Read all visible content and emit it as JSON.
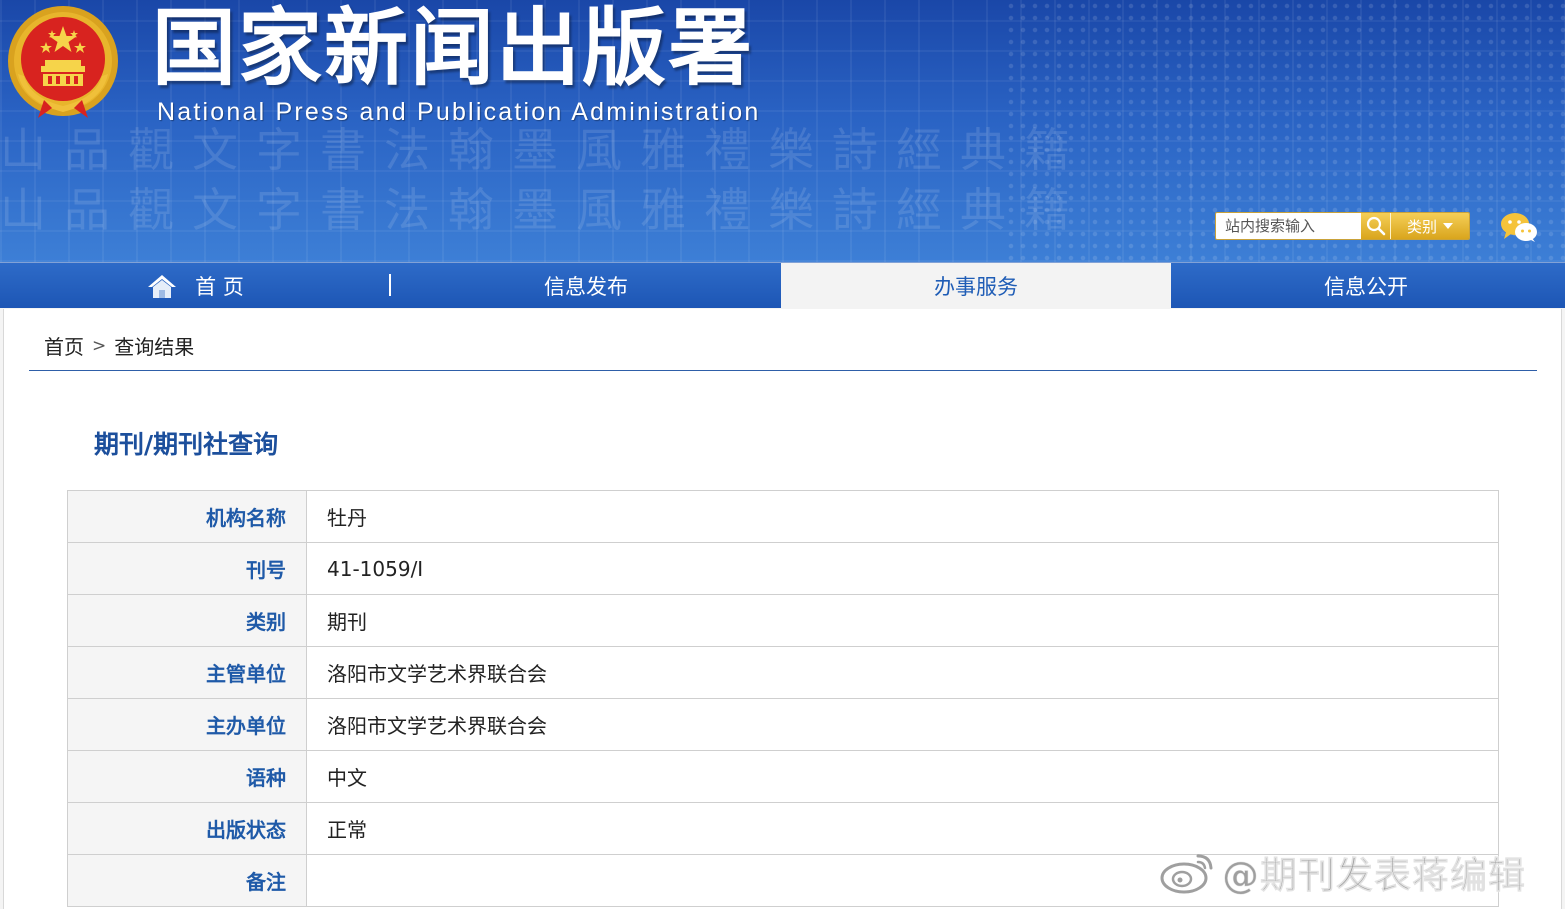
{
  "header": {
    "title": "国家新闻出版署",
    "subtitle": "National  Press and Publication Administration",
    "banner_glyphs": "山品觀文字書法翰墨風雅禮樂詩經典籍"
  },
  "search": {
    "placeholder": "站内搜索输入",
    "category_label": "类别"
  },
  "nav": {
    "items": [
      {
        "label": "首 页",
        "icon": "home-icon"
      },
      {
        "label": "信息发布"
      },
      {
        "label": "办事服务",
        "active": true
      },
      {
        "label": "信息公开"
      }
    ]
  },
  "breadcrumb": {
    "home": "首页",
    "separator": ">",
    "current": "查询结果"
  },
  "page_title": "期刊/期刊社查询",
  "table": {
    "rows": [
      {
        "label": "机构名称",
        "value": "牡丹"
      },
      {
        "label": "刊号",
        "value": "41-1059/I"
      },
      {
        "label": "类别",
        "value": "期刊"
      },
      {
        "label": "主管单位",
        "value": "洛阳市文学艺术界联合会"
      },
      {
        "label": "主办单位",
        "value": "洛阳市文学艺术界联合会"
      },
      {
        "label": "语种",
        "value": "中文"
      },
      {
        "label": "出版状态",
        "value": "正常"
      },
      {
        "label": "备注",
        "value": ""
      }
    ]
  },
  "watermark": {
    "text": "@期刊发表蒋编辑",
    "icon": "weibo-icon"
  },
  "colors": {
    "banner_blue": "#1a47a8",
    "nav_blue": "#1d56b5",
    "label_blue": "#1f5aa8",
    "title_blue": "#1c4f9c",
    "search_gold": "#d9a51d"
  }
}
